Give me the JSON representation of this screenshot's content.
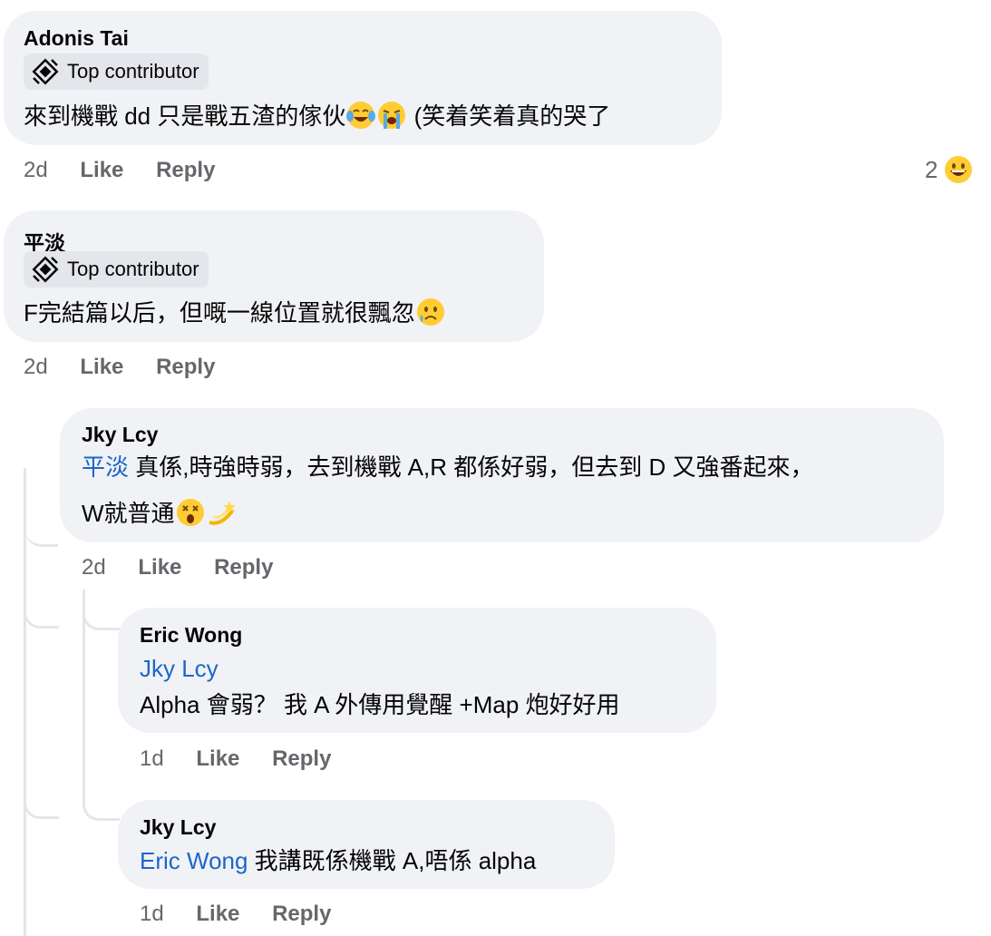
{
  "comments": [
    {
      "author": "Adonis Tai",
      "badge": "Top contributor",
      "text_before": "來到機戰 dd 只是戰五渣的傢伙",
      "text_after": " (笑着笑着真的哭了",
      "emojis": [
        "face-with-tears-of-joy",
        "loudly-crying-face"
      ],
      "time": "2d",
      "like": "Like",
      "reply": "Reply",
      "reaction_count": "2",
      "reaction_emoji": "grinning-face"
    },
    {
      "author": "平淡",
      "badge": "Top contributor",
      "text": "F完結篇以后，但嘅一線位置就很飄忽",
      "emojis": [
        "crying-face"
      ],
      "time": "2d",
      "like": "Like",
      "reply": "Reply"
    },
    {
      "author": "Jky Lcy",
      "mention": "平淡",
      "line1": " 真係,時強時弱，去到機戰 A,R 都係好弱，但去到 D 又強番起來，",
      "line2": "W就普通",
      "emojis": [
        "dizzy-face",
        "dizzy-symbol"
      ],
      "time": "2d",
      "like": "Like",
      "reply": "Reply"
    },
    {
      "author": "Eric Wong",
      "mention": "Jky Lcy",
      "text": "Alpha 會弱？ 我 A 外傳用覺醒 +Map 炮好好用",
      "time": "1d",
      "like": "Like",
      "reply": "Reply"
    },
    {
      "author": "Jky Lcy",
      "mention": "Eric Wong",
      "text": " 我講既係機戰 A,唔係 alpha",
      "time": "1d",
      "like": "Like",
      "reply": "Reply"
    }
  ]
}
